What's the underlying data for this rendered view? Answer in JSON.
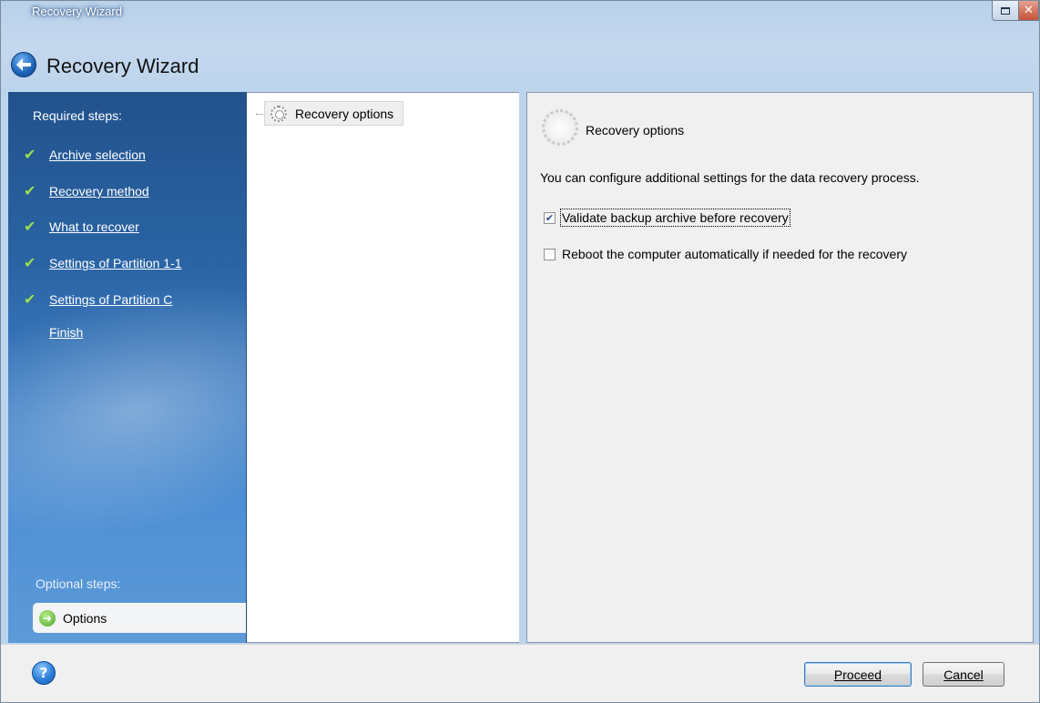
{
  "window": {
    "title": "Recovery Wizard",
    "header_title": "Recovery Wizard"
  },
  "sidebar": {
    "required_heading": "Required steps:",
    "steps": [
      {
        "label": "Archive selection",
        "done": true
      },
      {
        "label": "Recovery method",
        "done": true
      },
      {
        "label": "What to recover",
        "done": true
      },
      {
        "label": "Settings of Partition 1-1",
        "done": true
      },
      {
        "label": "Settings of Partition C",
        "done": true
      },
      {
        "label": "Finish",
        "done": false
      }
    ],
    "optional_heading": "Optional steps:",
    "optional_items": [
      {
        "label": "Options",
        "active": true
      }
    ]
  },
  "tree": {
    "nodes": [
      {
        "label": "Recovery options",
        "icon": "gear-icon"
      }
    ]
  },
  "panel": {
    "title": "Recovery options",
    "description": "You can configure additional settings for the data recovery process.",
    "options": [
      {
        "label": "Validate backup archive before recovery",
        "checked": true,
        "focused": true
      },
      {
        "label": "Reboot the computer automatically if needed for the recovery",
        "checked": false,
        "focused": false
      }
    ]
  },
  "footer": {
    "help_glyph": "?",
    "proceed_label": "Proceed",
    "cancel_label": "Cancel"
  },
  "icons": {
    "back": "back-arrow-icon",
    "help": "help-icon",
    "check": "checkmark-icon",
    "options_arrow": "arrow-right-icon"
  },
  "colors": {
    "sidebar_top": "#22528c",
    "sidebar_bottom": "#5d9ad8",
    "check_green": "#9be05c",
    "window_frame": "#b9d1ea"
  }
}
